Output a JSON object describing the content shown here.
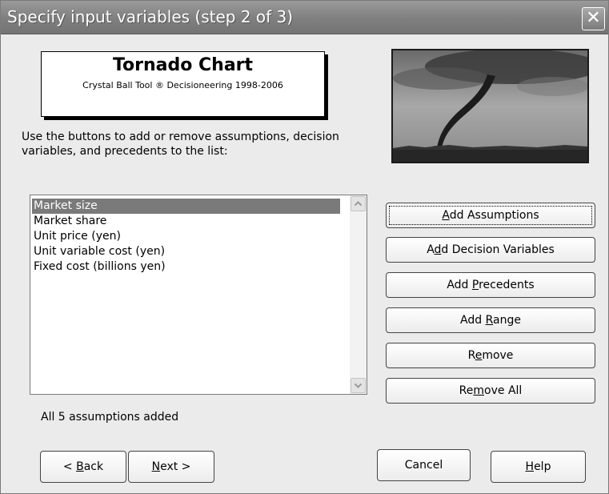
{
  "window": {
    "title": "Specify input variables (step 2 of 3)",
    "close_glyph": "✕"
  },
  "logo": {
    "title": "Tornado Chart",
    "subtitle": "Crystal Ball Tool ® Decisioneering 1998-2006"
  },
  "image": {
    "icon": "tornado-image"
  },
  "instructions": "Use the buttons to add or remove assumptions, decision variables, and precedents to the list:",
  "list": {
    "items": [
      "Market size",
      "Market share",
      "Unit price (yen)",
      "Unit variable cost (yen)",
      "Fixed cost (billions yen)"
    ],
    "selected_index": 0
  },
  "buttons": {
    "add_assumptions": {
      "pre": "",
      "key": "A",
      "post": "dd Assumptions"
    },
    "add_decision_variables": {
      "pre": "A",
      "key": "d",
      "post": "d Decision Variables"
    },
    "add_precedents": {
      "pre": "Add ",
      "key": "P",
      "post": "recedents"
    },
    "add_range": {
      "pre": "Add ",
      "key": "R",
      "post": "ange"
    },
    "remove": {
      "pre": "R",
      "key": "e",
      "post": "move"
    },
    "remove_all": {
      "pre": "Re",
      "key": "m",
      "post": "ove All"
    }
  },
  "status": "All 5 assumptions added",
  "footer": {
    "back": {
      "pre": "< ",
      "key": "B",
      "post": "ack"
    },
    "next": {
      "pre": "",
      "key": "N",
      "post": "ext >"
    },
    "cancel": "Cancel",
    "help": {
      "pre": "",
      "key": "H",
      "post": "elp"
    }
  },
  "colors": {
    "titlebar": "#8a8a8a",
    "dialog_bg": "#ebebeb",
    "selection": "#7a7a7a"
  }
}
